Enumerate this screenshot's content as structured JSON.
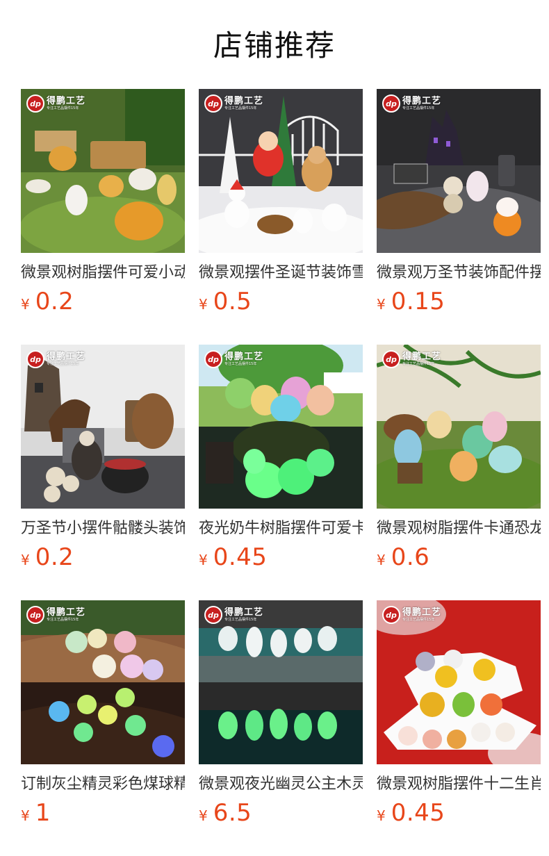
{
  "page": {
    "title": "店铺推荐"
  },
  "brand": {
    "name": "得鹏工艺",
    "tagline": "专注工艺品摆件15年",
    "mark": "dp",
    "mark_color": "#c71f1f"
  },
  "accent_color": "#e8461a",
  "products": [
    {
      "name": "微景观树脂摆件可爱小动物",
      "currency": "¥",
      "price": "0.2",
      "scene": "farm-animals"
    },
    {
      "name": "微景观摆件圣诞节装饰雪人",
      "currency": "¥",
      "price": "0.5",
      "scene": "christmas"
    },
    {
      "name": "微景观万圣节装饰配件摆件",
      "currency": "¥",
      "price": "0.15",
      "scene": "halloween-zombie"
    },
    {
      "name": "万圣节小摆件骷髅头装饰品",
      "currency": "¥",
      "price": "0.2",
      "scene": "halloween-skull"
    },
    {
      "name": "夜光奶牛树脂摆件可爱卡通",
      "currency": "¥",
      "price": "0.45",
      "scene": "glow-cows"
    },
    {
      "name": "微景观树脂摆件卡通恐龙",
      "currency": "¥",
      "price": "0.6",
      "scene": "dinosaurs"
    },
    {
      "name": "订制灰尘精灵彩色煤球精灵",
      "currency": "¥",
      "price": "1",
      "scene": "soot-sprites"
    },
    {
      "name": "微景观夜光幽灵公主木灵",
      "currency": "¥",
      "price": "6.5",
      "scene": "kodama"
    },
    {
      "name": "微景观树脂摆件十二生肖",
      "currency": "¥",
      "price": "0.45",
      "scene": "zodiac"
    }
  ]
}
